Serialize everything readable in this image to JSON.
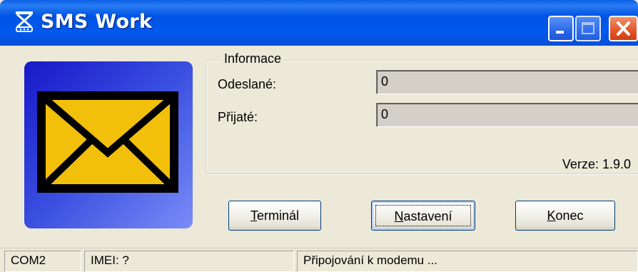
{
  "window": {
    "title": "SMS Work",
    "controls": {
      "minimize": "minimize-icon",
      "maximize": "maximize-icon",
      "close": "close-icon"
    },
    "colors": {
      "titlebar": "#0054e3",
      "close_button": "#e35a2c",
      "envelope_fill": "#f2c00a",
      "envelope_panel": "#2a3ad8"
    }
  },
  "info": {
    "group_title": "Informace",
    "sent_label": "Odeslané:",
    "sent_value": "0",
    "received_label": "Přijaté:",
    "received_value": "0",
    "version": "Verze: 1.9.0"
  },
  "buttons": {
    "terminal_mnemonic": "T",
    "terminal_rest": "erminál",
    "settings_mnemonic": "N",
    "settings_rest": "astavení",
    "exit_mnemonic": "K",
    "exit_rest": "onec"
  },
  "statusbar": {
    "port": "COM2",
    "imei": "IMEI: ?",
    "status": "Připojování k modemu ..."
  }
}
